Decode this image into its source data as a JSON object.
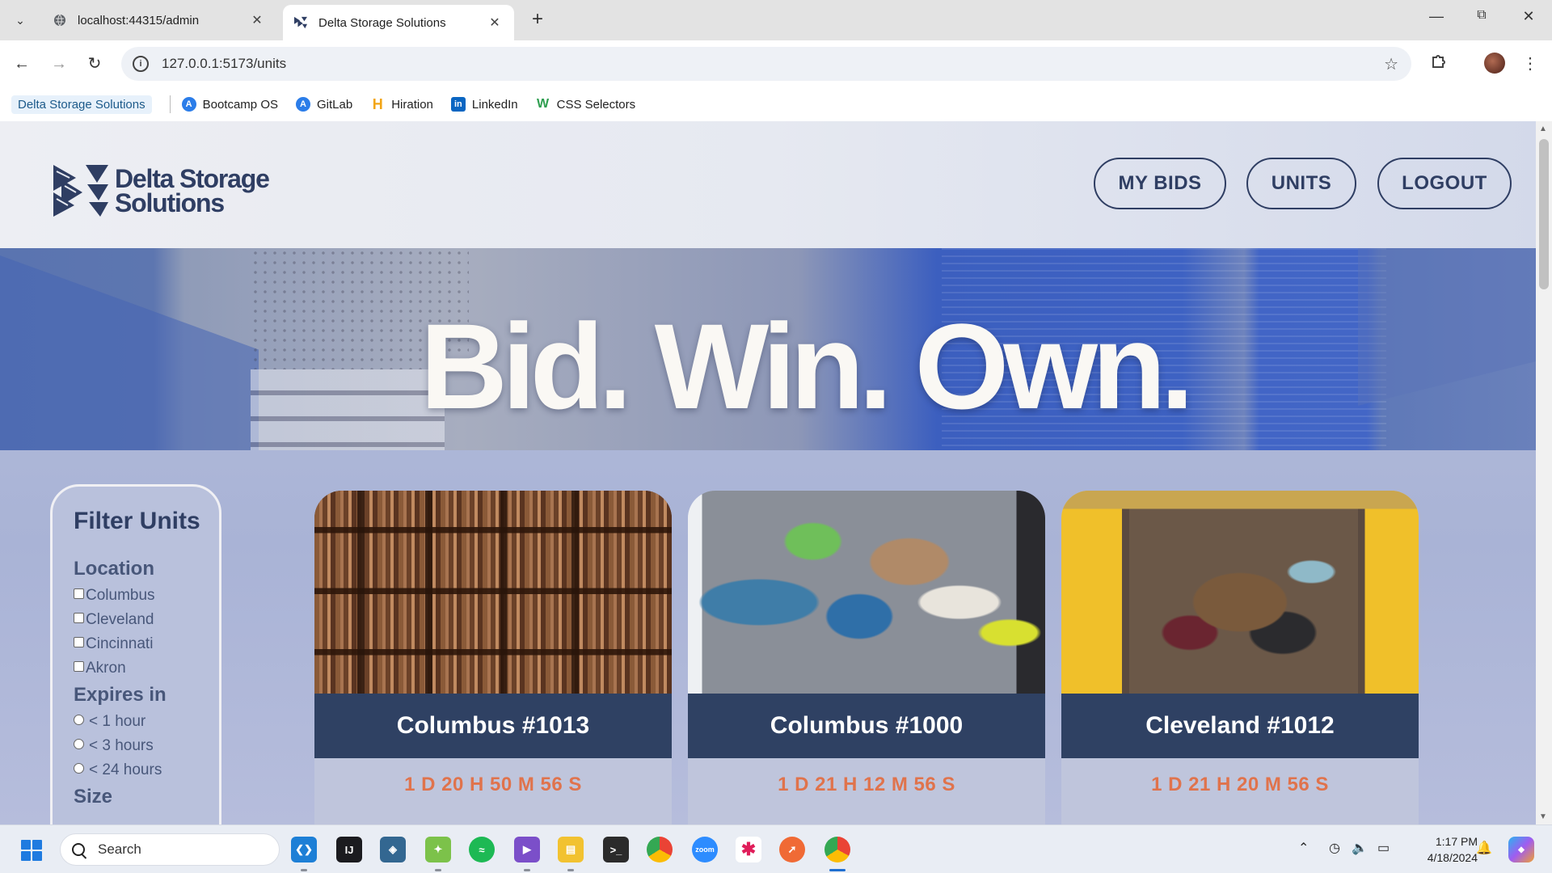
{
  "browser": {
    "tabs": [
      {
        "title": "localhost:44315/admin",
        "active": false
      },
      {
        "title": "Delta Storage Solutions",
        "active": true
      }
    ],
    "url": "127.0.0.1:5173/units",
    "bookmarks": [
      {
        "label": "Delta Storage Solutions",
        "icon": "delta-logo"
      },
      {
        "label": "Bootcamp OS",
        "icon": "bootcamp-icon"
      },
      {
        "label": "GitLab",
        "icon": "gitlab-icon"
      },
      {
        "label": "Hiration",
        "icon": "hiration-icon"
      },
      {
        "label": "LinkedIn",
        "icon": "linkedin-icon"
      },
      {
        "label": "CSS Selectors",
        "icon": "css-selectors-icon"
      }
    ]
  },
  "site": {
    "logo_line1": "Delta Storage",
    "logo_line2": "Solutions",
    "nav": [
      "MY BIDS",
      "UNITS",
      "LOGOUT"
    ],
    "hero_title": "Bid. Win. Own."
  },
  "filters": {
    "title": "Filter Units",
    "location_label": "Location",
    "locations": [
      "Columbus",
      "Cleveland",
      "Cincinnati",
      "Akron"
    ],
    "expires_label": "Expires in",
    "expires": [
      "< 1 hour",
      "< 3 hours",
      "< 24 hours"
    ],
    "size_label": "Size"
  },
  "units": [
    {
      "name": "Columbus #1013",
      "timer": "1 D 20 H 50 M 56 S"
    },
    {
      "name": "Columbus #1000",
      "timer": "1 D 21 H 12 M 56 S"
    },
    {
      "name": "Cleveland #1012",
      "timer": "1 D 21 H 20 M 56 S"
    }
  ],
  "taskbar": {
    "search_placeholder": "Search",
    "time": "1:17 PM",
    "date": "4/18/2024"
  },
  "colors": {
    "brand_navy": "#2f3e63",
    "card_header": "#2f4163",
    "timer": "#e0734c"
  }
}
